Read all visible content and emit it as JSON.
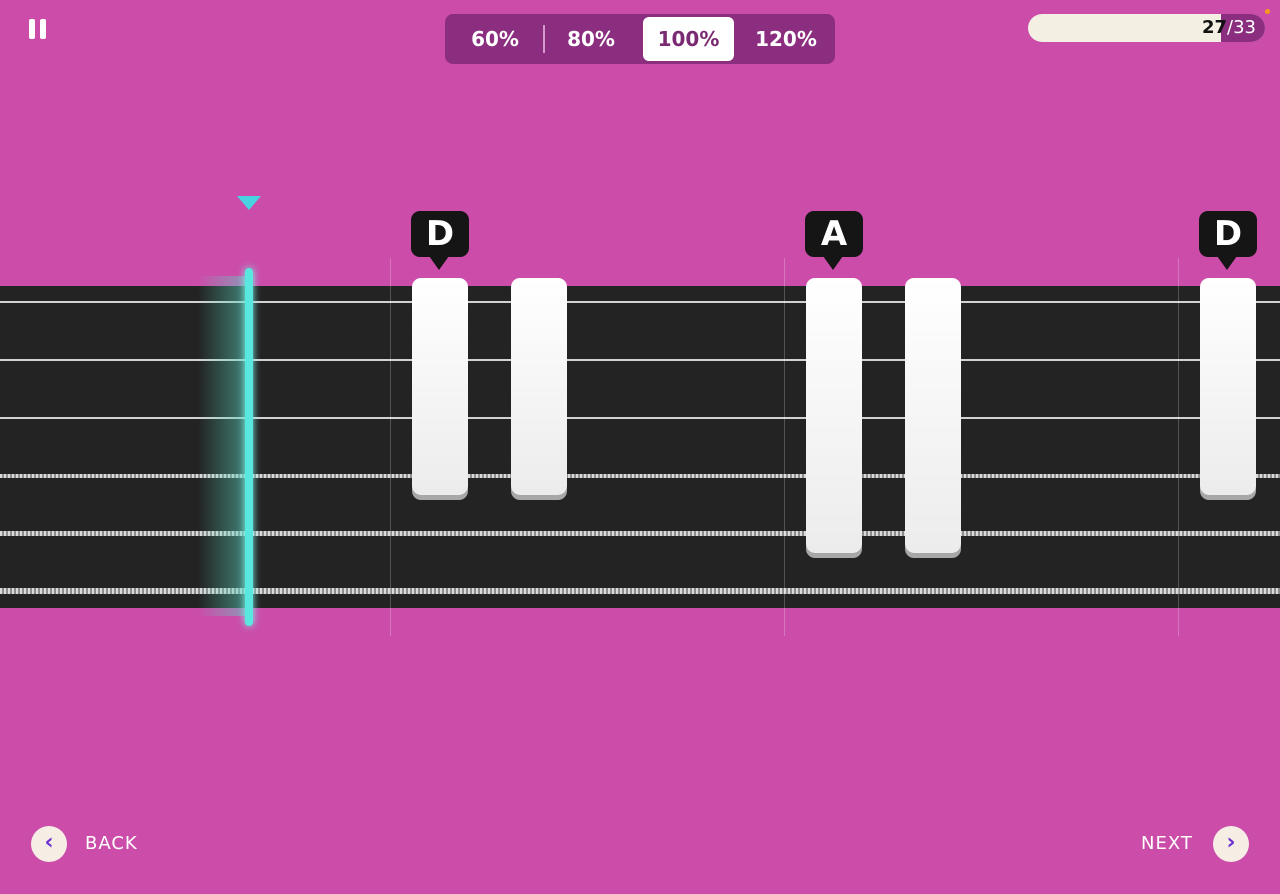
{
  "controls": {
    "pause_icon": "pause-icon"
  },
  "speed": {
    "options": [
      "60%",
      "80%",
      "100%",
      "120%"
    ],
    "selected": "100%"
  },
  "progress": {
    "current": "27",
    "separator": "/",
    "total": "33",
    "fraction": 0.818
  },
  "chords": [
    {
      "label": "D"
    },
    {
      "label": "A"
    },
    {
      "label": "D"
    }
  ],
  "navigation": {
    "back_label": "BACK",
    "next_label": "NEXT",
    "back_icon": "chevron-left-icon",
    "next_icon": "chevron-right-icon"
  },
  "colors": {
    "background": "#cb4da9",
    "fretboard": "#232323",
    "playhead": "#58e8df",
    "accent_dark": "#8b2e80",
    "nav_icon": "#6b2fd0"
  }
}
